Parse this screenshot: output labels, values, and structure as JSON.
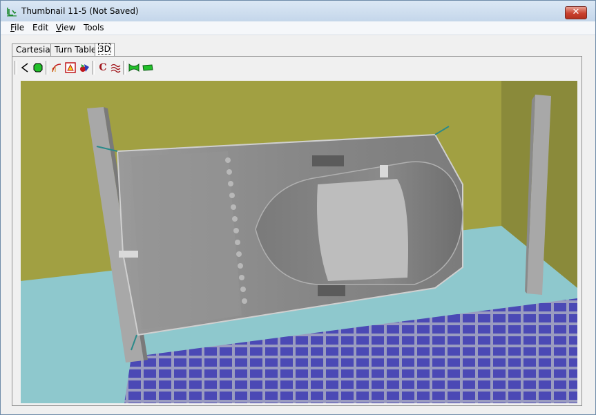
{
  "window": {
    "title": "Thumbnail 11-5 (Not Saved)",
    "close_label": "✕"
  },
  "menu": [
    {
      "label": "File",
      "mnemonic": "F",
      "rest": "ile"
    },
    {
      "label": "Edit",
      "mnemonic": "",
      "rest": "Edit"
    },
    {
      "label": "View",
      "mnemonic": "V",
      "rest": "iew"
    },
    {
      "label": "Tools",
      "mnemonic": "",
      "rest": "Tools"
    }
  ],
  "tabs": [
    {
      "label": "Cartesian",
      "active": false
    },
    {
      "label": "Turn Table",
      "active": false
    },
    {
      "label": "3D",
      "active": true
    }
  ],
  "toolbar": {
    "buttons": [
      {
        "icon": "triangle-left-icon"
      },
      {
        "icon": "green-octagon-icon"
      },
      {
        "icon": "curve-icon"
      },
      {
        "icon": "warning-triangle-icon"
      },
      {
        "icon": "colored-shapes-icon"
      },
      {
        "icon": "c-icon",
        "label": "C"
      },
      {
        "icon": "wave-lines-icon"
      },
      {
        "icon": "green-pipe-icon"
      },
      {
        "icon": "green-tube-icon"
      }
    ]
  },
  "scene": {
    "colors": {
      "wall": "#a1a042",
      "floor": "#8ec8cd",
      "grid_cell": "#4b49b5",
      "grid_line": "#9a9cc0",
      "post": "#a8a8a8",
      "part": "#8d8d8d"
    }
  }
}
